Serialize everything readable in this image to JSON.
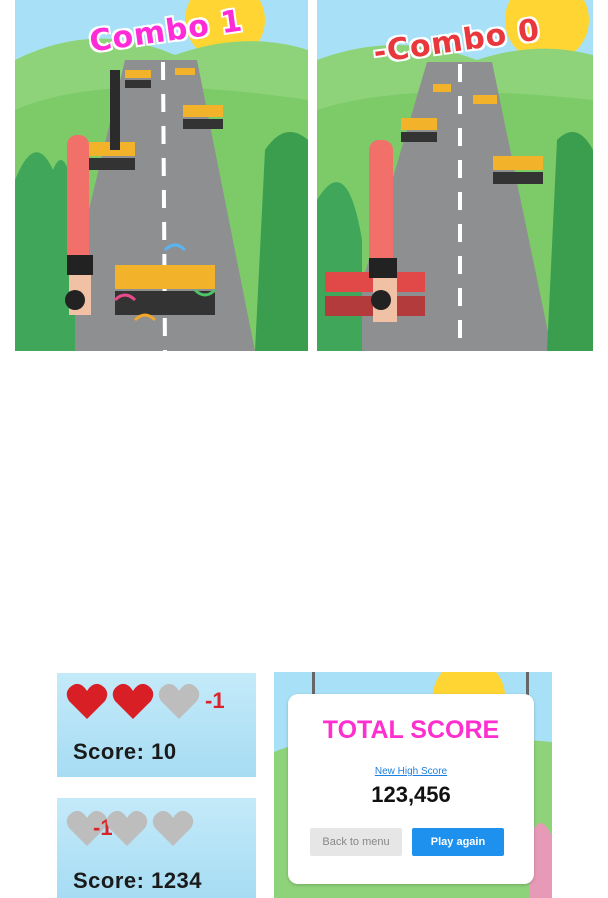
{
  "gameplay": {
    "left_panel": {
      "combo_text": "Combo 1"
    },
    "right_panel": {
      "combo_text": "-Combo 0"
    }
  },
  "hud_full": {
    "hearts": [
      "heart-full",
      "heart-full",
      "heart-empty"
    ],
    "lives_change": "-1",
    "score_text": "Score: 10"
  },
  "hud_low": {
    "hearts": [
      "heart-empty",
      "heart-empty",
      "heart-empty"
    ],
    "lives_change": "-1",
    "score_text": "Score: 1234"
  },
  "result_card": {
    "title": "TOTAL SCORE",
    "new_high_label": "New High Score",
    "score_value": "123,456",
    "back_button": "Back to menu",
    "play_button": "Play again"
  },
  "colors": {
    "heart_full": "#d81f26",
    "heart_empty": "#bdbdbd",
    "combo_positive": "#ff2bd6",
    "combo_negative": "#e8383d",
    "title_pink": "#ff2ecf",
    "accent_blue": "#1e90ee"
  }
}
